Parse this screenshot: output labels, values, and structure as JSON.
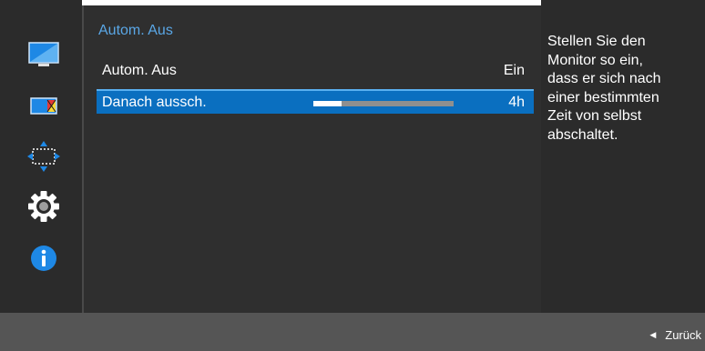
{
  "sidebar": {
    "icons": [
      {
        "name": "picture-icon"
      },
      {
        "name": "color-icon"
      },
      {
        "name": "size-position-icon"
      },
      {
        "name": "settings-icon"
      },
      {
        "name": "information-icon"
      }
    ],
    "accent_color": "#1e88e5"
  },
  "panel": {
    "title": "Autom. Aus",
    "rows": [
      {
        "label": "Autom. Aus",
        "value": "Ein"
      },
      {
        "label": "Danach aussch.",
        "value": "4h",
        "slider_fraction": 0.2
      }
    ],
    "highlight_color": "#0a6fc0",
    "title_color": "#5aa7e6"
  },
  "description": {
    "lines": [
      "Stellen Sie den",
      "Monitor so ein,",
      "dass er sich nach",
      "einer bestimmten",
      "Zeit von selbst",
      "abschaltet."
    ]
  },
  "footer": {
    "back_label": "Zurück"
  }
}
